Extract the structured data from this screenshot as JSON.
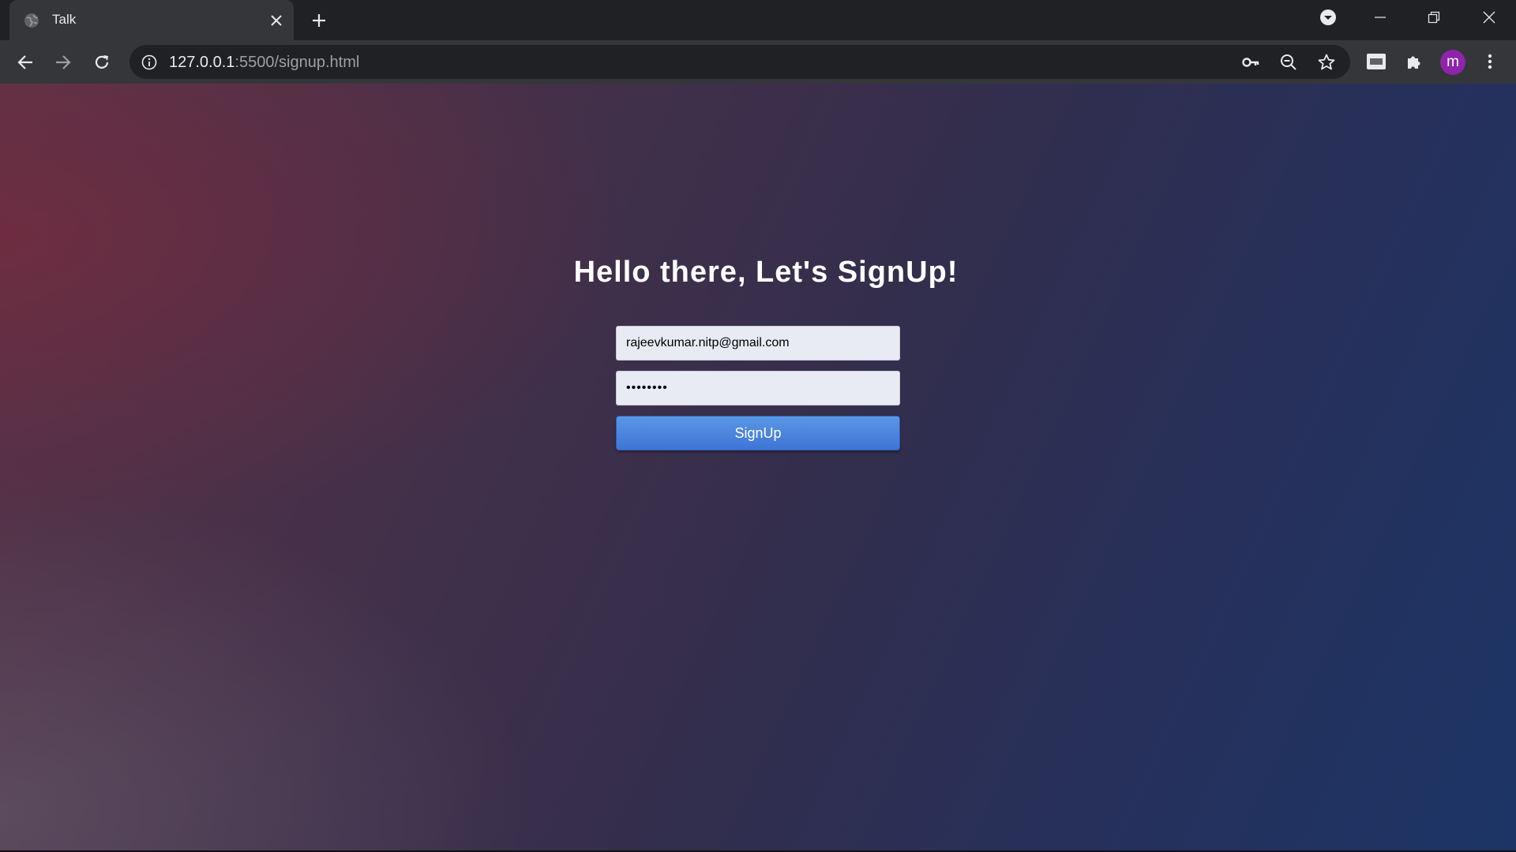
{
  "browser": {
    "tab": {
      "title": "Talk",
      "favicon": "globe-icon"
    },
    "address": {
      "host": "127.0.0.1",
      "rest": ":5500/signup.html"
    },
    "profile_initial": "m",
    "avatar_color": "#8e24aa"
  },
  "page": {
    "heading": "Hello there, Let's SignUp!",
    "email_value": "rajeevkumar.nitp@gmail.com",
    "password_value": "••••••••",
    "submit_label": "SignUp",
    "button_color": "#4a84dd"
  }
}
